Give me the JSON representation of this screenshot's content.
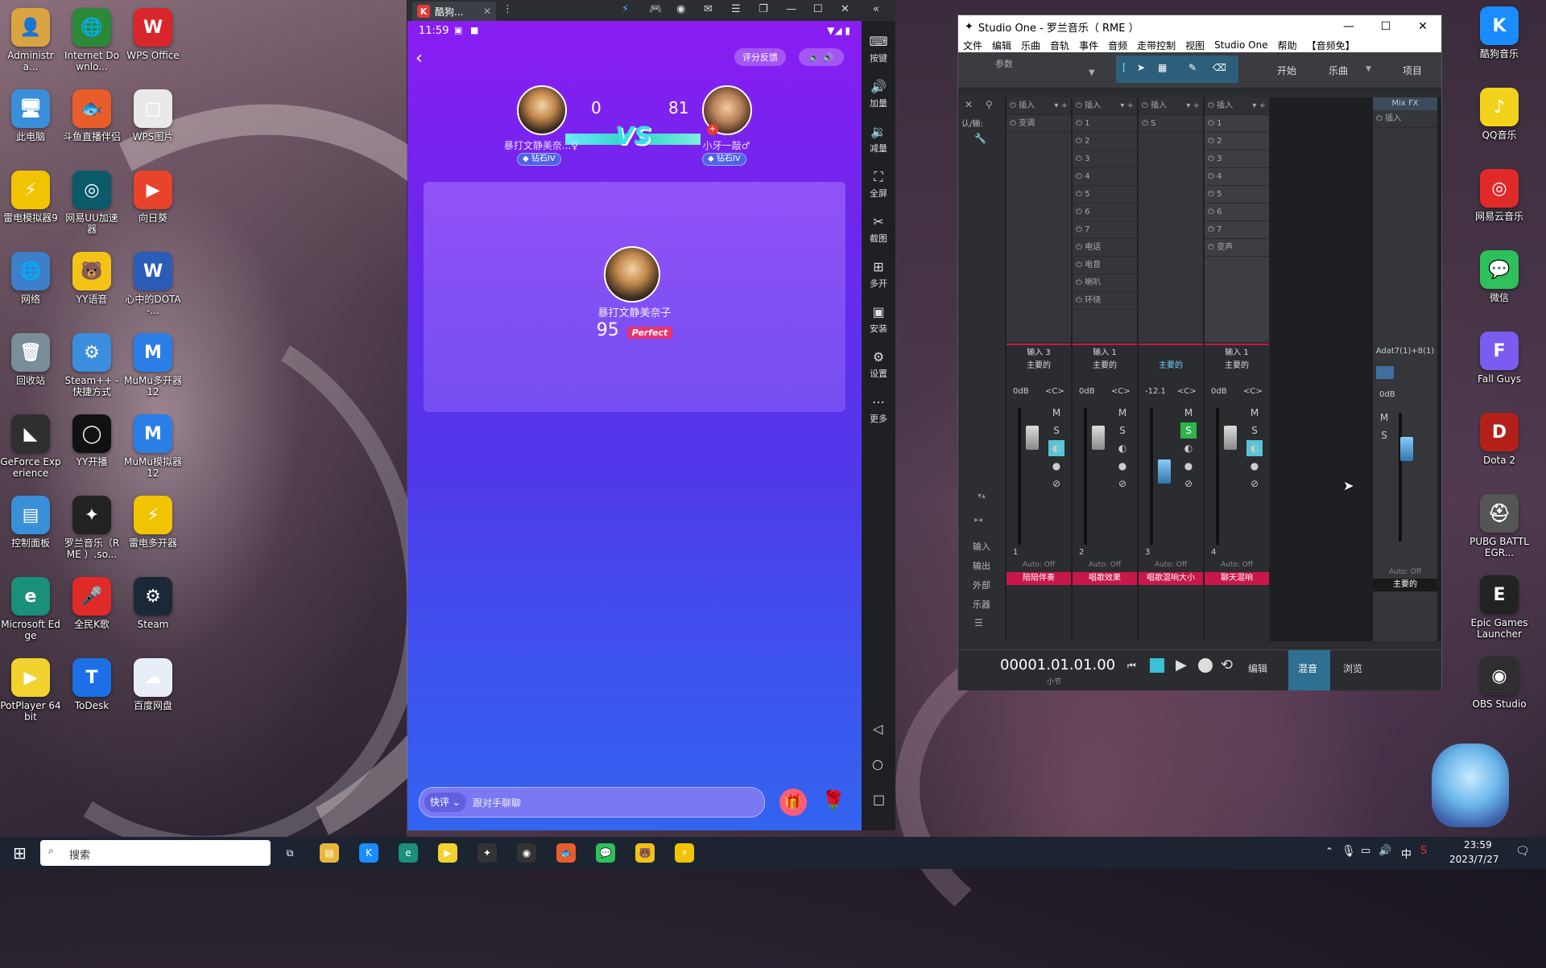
{
  "desktop": {
    "left_icons": [
      {
        "label": "Administra...",
        "icon": "user-folder-icon",
        "color": "#d9a441",
        "glyph": "👤"
      },
      {
        "label": "Internet Downlo...",
        "icon": "idm-icon",
        "color": "#2a8a3a",
        "glyph": "🌐"
      },
      {
        "label": "WPS Office",
        "icon": "wps-office-icon",
        "color": "#d9252c",
        "glyph": "W"
      },
      {
        "label": "此电脑",
        "icon": "this-pc-icon",
        "color": "#3a8fd9",
        "glyph": "🖥"
      },
      {
        "label": "斗鱼直播伴侣",
        "icon": "douyu-icon",
        "color": "#e85d2a",
        "glyph": "🐟"
      },
      {
        "label": "WPS图片",
        "icon": "wps-image-icon",
        "color": "#e9e9e9",
        "glyph": "▢"
      },
      {
        "label": "雷电模拟器9",
        "icon": "ldplayer-icon",
        "color": "#f2c300",
        "glyph": "⚡"
      },
      {
        "label": "网易UU加速器",
        "icon": "uu-accelerator-icon",
        "color": "#0a5a6a",
        "glyph": "◎"
      },
      {
        "label": "向日葵",
        "icon": "sunlogin-icon",
        "color": "#e8432b",
        "glyph": "▶"
      },
      {
        "label": "网络",
        "icon": "network-icon",
        "color": "#3d7fc9",
        "glyph": "🌐"
      },
      {
        "label": "YY语音",
        "icon": "yy-voice-icon",
        "color": "#f3c316",
        "glyph": "🐻"
      },
      {
        "label": "心中的DOTA-...",
        "icon": "word-doc-icon",
        "color": "#2b5cb8",
        "glyph": "W"
      },
      {
        "label": "回收站",
        "icon": "recycle-bin-icon",
        "color": "#7a8d9a",
        "glyph": "🗑"
      },
      {
        "label": "Steam++ - 快捷方式",
        "icon": "steam-plus-icon",
        "color": "#3b8ede",
        "glyph": "⚙"
      },
      {
        "label": "MuMu多开器12",
        "icon": "mumu-multi-icon",
        "color": "#2a7ee6",
        "glyph": "M"
      },
      {
        "label": "GeForce Experience",
        "icon": "geforce-icon",
        "color": "#2f2f2f",
        "glyph": "◣"
      },
      {
        "label": "YY开播",
        "icon": "yy-live-icon",
        "color": "#111",
        "glyph": "◯"
      },
      {
        "label": "MuMu模拟器12",
        "icon": "mumu-emulator-icon",
        "color": "#2a7ee6",
        "glyph": "M"
      },
      {
        "label": "控制面板",
        "icon": "control-panel-icon",
        "color": "#3a8fd9",
        "glyph": "▤"
      },
      {
        "label": "罗兰音乐（RME ）.so...",
        "icon": "studio-one-icon",
        "color": "#222",
        "glyph": "✦"
      },
      {
        "label": "雷电多开器",
        "icon": "ld-multi-icon",
        "color": "#f2c300",
        "glyph": "⚡"
      },
      {
        "label": "Microsoft Edge",
        "icon": "edge-icon",
        "color": "#1a8f7a",
        "glyph": "e"
      },
      {
        "label": "全民K歌",
        "icon": "quanmin-kge-icon",
        "color": "#e02a2a",
        "glyph": "🎤"
      },
      {
        "label": "Steam",
        "icon": "steam-icon",
        "color": "#1b2838",
        "glyph": "⚙"
      },
      {
        "label": "PotPlayer 64 bit",
        "icon": "potplayer-icon",
        "color": "#f2d22e",
        "glyph": "▶"
      },
      {
        "label": "ToDesk",
        "icon": "todesk-icon",
        "color": "#1d6fe8",
        "glyph": "T"
      },
      {
        "label": "百度网盘",
        "icon": "baidu-netdisk-icon",
        "color": "#e8eef8",
        "glyph": "☁"
      }
    ],
    "right_icons": [
      {
        "label": "酷狗音乐",
        "icon": "kugou-icon",
        "color": "#1a8cff",
        "glyph": "K"
      },
      {
        "label": "QQ音乐",
        "icon": "qq-music-icon",
        "color": "#f3d21b",
        "glyph": "♪"
      },
      {
        "label": "网易云音乐",
        "icon": "netease-music-icon",
        "color": "#e02a2a",
        "glyph": "◎"
      },
      {
        "label": "微信",
        "icon": "wechat-icon",
        "color": "#2ec05a",
        "glyph": "💬"
      },
      {
        "label": "Fall Guys",
        "icon": "fall-guys-icon",
        "color": "#7b5cf0",
        "glyph": "F"
      },
      {
        "label": "Dota 2",
        "icon": "dota2-icon",
        "color": "#b3201a",
        "glyph": "D"
      },
      {
        "label": "PUBG BATTLEGR...",
        "icon": "pubg-icon",
        "color": "#555",
        "glyph": "⛑"
      },
      {
        "label": "Epic Games Launcher",
        "icon": "epic-games-icon",
        "color": "#222",
        "glyph": "E"
      },
      {
        "label": "OBS Studio",
        "icon": "obs-icon",
        "color": "#302e31",
        "glyph": "◉"
      }
    ]
  },
  "emulator": {
    "tab_title": "酷狗...",
    "tab_logo": "K",
    "status_time": "11:59",
    "sidebar": [
      {
        "label": "按键",
        "icon": "keyboard-icon",
        "glyph": "⌨"
      },
      {
        "label": "加量",
        "icon": "volume-up-icon",
        "glyph": "🔊"
      },
      {
        "label": "减量",
        "icon": "volume-down-icon",
        "glyph": "🔉"
      },
      {
        "label": "全屏",
        "icon": "fullscreen-icon",
        "glyph": "⛶"
      },
      {
        "label": "截图",
        "icon": "scissors-icon",
        "glyph": "✂"
      },
      {
        "label": "多开",
        "icon": "multi-open-icon",
        "glyph": "⊞"
      },
      {
        "label": "安装",
        "icon": "apk-install-icon",
        "glyph": "▣"
      },
      {
        "label": "设置",
        "icon": "settings-icon",
        "glyph": "⚙"
      },
      {
        "label": "更多",
        "icon": "more-icon",
        "glyph": "⋯"
      }
    ]
  },
  "app": {
    "feedback_btn": "评分反馈",
    "player_a": {
      "name": "暴打文静美奈...♀",
      "score": "0",
      "badge": "钻石IV"
    },
    "player_b": {
      "name": "小牙一敲♂",
      "score": "81",
      "badge": "钻石IV"
    },
    "vs": "VS",
    "result_name": "暴打文静美奈子",
    "result_score": "95",
    "result_grade": "Perfect",
    "chat_quick": "快评",
    "chat_placeholder": "跟对手聊聊"
  },
  "studio_one": {
    "title": "Studio One - 罗兰音乐（ RME ）",
    "menu": [
      "文件",
      "编辑",
      "乐曲",
      "音轨",
      "事件",
      "音频",
      "走带控制",
      "视图",
      "Studio One",
      "帮助",
      "【音频免】"
    ],
    "toolbar": {
      "param_label": "参数",
      "start": "开始",
      "song": "乐曲",
      "project": "项目"
    },
    "side_labels": [
      "输入",
      "输出",
      "外部",
      "乐器"
    ],
    "left_header": "认/输:",
    "strips": [
      {
        "insert_head": "插入",
        "inserts": [
          "变调"
        ],
        "input": "输入 3",
        "output": "主要的",
        "db": "0dB",
        "num": "1",
        "auto": "Auto: Off",
        "name": "陪陪伴奏",
        "name_color": "#c8174a",
        "solo": false
      },
      {
        "insert_head": "插入",
        "inserts": [
          "1",
          "2",
          "3",
          "4",
          "5",
          "6",
          "7",
          "电话",
          "电音",
          "喇叭",
          "环绕"
        ],
        "input": "输入 1",
        "output": "主要的",
        "db": "0dB",
        "num": "2",
        "auto": "Auto: Off",
        "name": "唱歌效果",
        "name_color": "#c8174a",
        "solo": false
      },
      {
        "insert_head": "插入",
        "inserts": [
          "S"
        ],
        "input": "",
        "output": "主要的",
        "db": "-12.1",
        "num": "3",
        "auto": "Auto: Off",
        "name": "唱歌混响大小",
        "name_color": "#c8174a",
        "solo": true
      },
      {
        "insert_head": "插入",
        "inserts": [
          "1",
          "2",
          "3",
          "4",
          "5",
          "6",
          "7",
          "变声"
        ],
        "input": "输入 1",
        "output": "主要的",
        "db": "0dB",
        "num": "4",
        "auto": "Auto: Off",
        "name": "聊天混响",
        "name_color": "#c8174a",
        "solo": false
      }
    ],
    "main": {
      "head": "Mix FX",
      "insert": "插入",
      "io": "Adat7(1)+8(1)",
      "db": "0dB",
      "auto": "Auto: Off",
      "name": "主要的"
    },
    "mute": "M",
    "solo": "S",
    "transport": {
      "time": "00001.01.01.00",
      "unit": "小节",
      "edit": "编辑",
      "mix": "混音",
      "browse": "浏览"
    }
  },
  "taskbar": {
    "search": "搜索",
    "time": "23:59",
    "date": "2023/7/27",
    "ime": "中",
    "apps": [
      {
        "icon": "task-view-icon",
        "color": "transparent",
        "glyph": "⧉"
      },
      {
        "icon": "file-explorer-icon",
        "color": "#e8b73a",
        "glyph": "▤"
      },
      {
        "icon": "kugou-taskbar-icon",
        "color": "#1a8cff",
        "glyph": "K"
      },
      {
        "icon": "edge-taskbar-icon",
        "color": "#1a8f7a",
        "glyph": "e"
      },
      {
        "icon": "potplayer-taskbar-icon",
        "color": "#f2d22e",
        "glyph": "▶"
      },
      {
        "icon": "studio-one-taskbar-icon",
        "color": "#333",
        "glyph": "✦"
      },
      {
        "icon": "obs-taskbar-icon",
        "color": "#333",
        "glyph": "◉"
      },
      {
        "icon": "douyu-taskbar-icon",
        "color": "#e85d2a",
        "glyph": "🐟"
      },
      {
        "icon": "wechat-taskbar-icon",
        "color": "#2ec05a",
        "glyph": "💬"
      },
      {
        "icon": "yy-taskbar-icon",
        "color": "#f3c316",
        "glyph": "🐻"
      },
      {
        "icon": "ldplayer-taskbar-icon",
        "color": "#f2c300",
        "glyph": "⚡"
      }
    ]
  }
}
